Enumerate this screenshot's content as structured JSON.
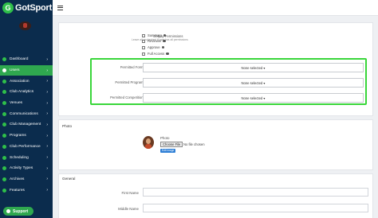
{
  "app": {
    "logo_text": "GotSport",
    "logo_mark": "G"
  },
  "sidebar": {
    "items": [
      {
        "label": "Dashboard",
        "icon": "dashboard-icon"
      },
      {
        "label": "Users",
        "icon": "users-icon",
        "active": true
      },
      {
        "label": "Association",
        "icon": "association-icon"
      },
      {
        "label": "Club Analytics",
        "icon": "analytics-icon"
      },
      {
        "label": "Venues",
        "icon": "venues-icon"
      },
      {
        "label": "Communications",
        "icon": "communications-icon"
      },
      {
        "label": "Club Management",
        "icon": "club-management-icon"
      },
      {
        "label": "Programs",
        "icon": "programs-icon"
      },
      {
        "label": "Club Performance",
        "icon": "performance-icon"
      },
      {
        "label": "Scheduling",
        "icon": "scheduling-icon"
      },
      {
        "label": "Activity Types",
        "icon": "activity-types-icon"
      },
      {
        "label": "Archives",
        "icon": "archives-icon"
      },
      {
        "label": "Features",
        "icon": "features-icon"
      }
    ],
    "support_label": "Support"
  },
  "permissions": {
    "gotpay_label": "Gotpay Permissions",
    "gotpay_sub": "Leave all unchecked if user has all permissions",
    "checkboxes": [
      "Summary",
      "Reviewer",
      "Approve",
      "Full Access"
    ],
    "permitted": [
      {
        "label": "Permitted Form IDs",
        "value": "None selected ▾"
      },
      {
        "label": "Permitted Program IDs",
        "value": "None selected ▾"
      },
      {
        "label": "Permitted Competition IDs",
        "value": "None selected ▾"
      }
    ]
  },
  "photo": {
    "section_title": "Photo",
    "field_label": "Photo",
    "choose_file": "Choose File",
    "no_file": "No file chosen",
    "edit_badge": "Edit Image"
  },
  "general": {
    "section_title": "General",
    "fields": [
      {
        "label": "First Name"
      },
      {
        "label": "Middle Name"
      }
    ]
  },
  "colors": {
    "sidebar_bg": "#0b2c4d",
    "accent_green": "#2fa84f",
    "highlight_green": "#39d63a"
  }
}
